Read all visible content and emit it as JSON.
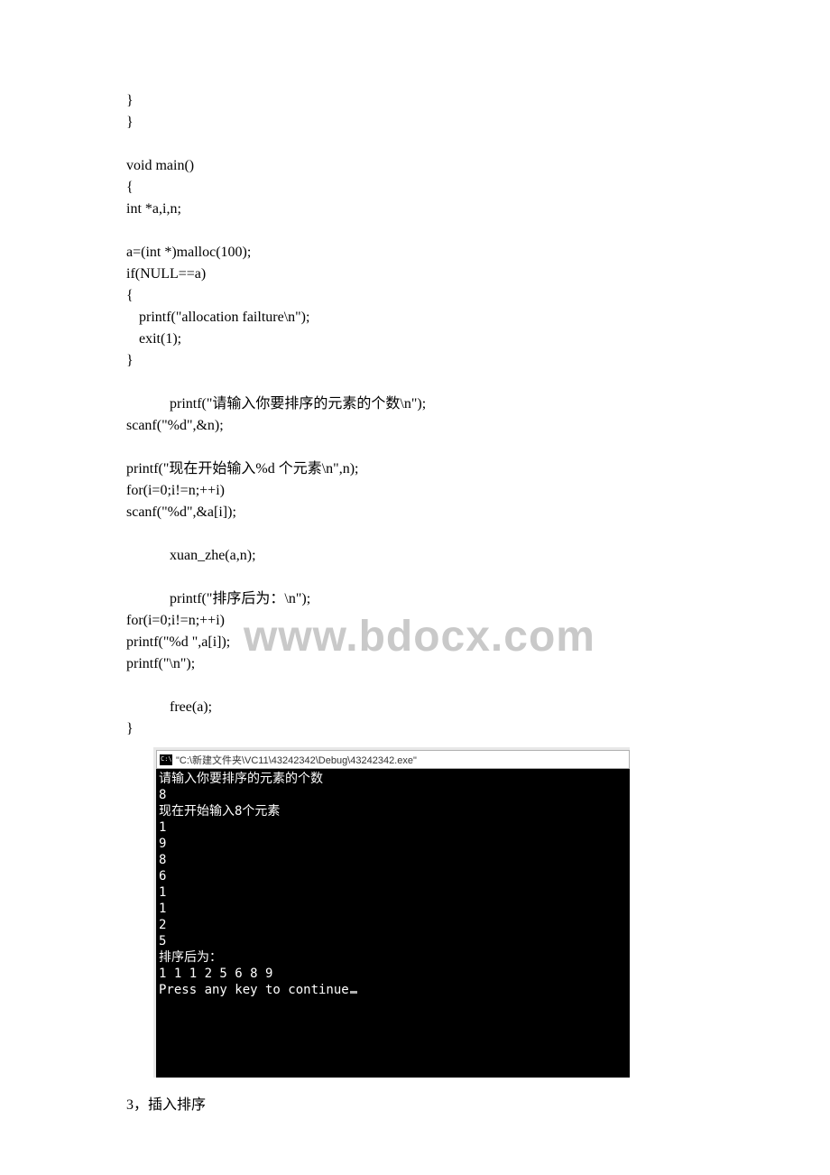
{
  "code": {
    "l1": "}",
    "l2": "}",
    "l3": "void main()",
    "l4": "{",
    "l5": "int *a,i,n;",
    "l6": "a=(int *)malloc(100);",
    "l7": "if(NULL==a)",
    "l8": "{",
    "l9": "printf(\"allocation failture\\n\");",
    "l10": "exit(1);",
    "l11": "}",
    "l12": "printf(\"请输入你要排序的元素的个数\\n\");",
    "l13": "scanf(\"%d\",&n);",
    "l14": "printf(\"现在开始输入%d 个元素\\n\",n);",
    "l15": "for(i=0;i!=n;++i)",
    "l16": "scanf(\"%d\",&a[i]);",
    "l17": "xuan_zhe(a,n);",
    "l18": "printf(\"排序后为：\\n\");",
    "l19": "for(i=0;i!=n;++i)",
    "l20": "printf(\"%d \",a[i]);",
    "l21": "printf(\"\\n\");",
    "l22": "free(a);",
    "l23": "}"
  },
  "watermark": "www.bdocx.com",
  "console": {
    "title": "\"C:\\新建文件夹\\VC11\\43242342\\Debug\\43242342.exe\"",
    "lines": {
      "c1": "请输入你要排序的元素的个数",
      "c2": "8",
      "c3": "现在开始输入8个元素",
      "c4": "1",
      "c5": "9",
      "c6": "8",
      "c7": "6",
      "c8": "1",
      "c9": "1",
      "c10": "2",
      "c11": "5",
      "c12": "排序后为：",
      "c13": "1 1 1 2 5 6 8 9",
      "c14": "Press any key to continue"
    }
  },
  "footer": "3，插入排序"
}
